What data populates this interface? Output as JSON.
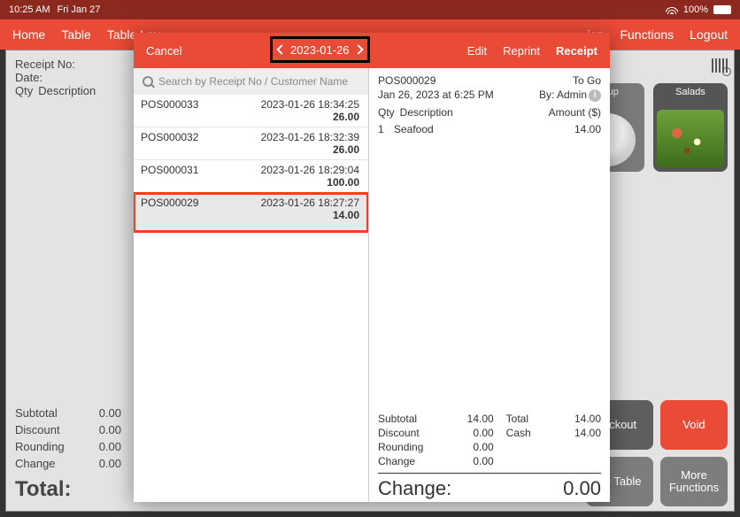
{
  "status": {
    "time": "10:25 AM",
    "date": "Fri Jan 27",
    "battery": "100%"
  },
  "topnav": {
    "home": "Home",
    "table": "Table",
    "layout": "Table Lay",
    "ion": "ion",
    "functions": "Functions",
    "logout": "Logout"
  },
  "background": {
    "receipt_no_label": "Receipt No:",
    "date_label": "Date:",
    "qty_label": "Qty",
    "desc_label": "Description",
    "subtotal_label": "Subtotal",
    "subtotal": "0.00",
    "discount_label": "Discount",
    "discount": "0.00",
    "rounding_label": "Rounding",
    "rounding": "0.00",
    "change_label": "Change",
    "change": "0.00",
    "total_label": "Total:",
    "products": {
      "soup": "Soup",
      "salads": "Salads"
    },
    "buttons": {
      "checkout": "eckout",
      "void": "Void",
      "change_table": "ge Table",
      "more": "More Functions"
    }
  },
  "modal": {
    "cancel": "Cancel",
    "date": "2023-01-26",
    "tabs": {
      "edit": "Edit",
      "reprint": "Reprint",
      "receipt": "Receipt"
    },
    "search_placeholder": "Search by Receipt No / Customer Name",
    "receipts": [
      {
        "no": "POS000033",
        "ts": "2023-01-26 18:34:25",
        "amt": "26.00"
      },
      {
        "no": "POS000032",
        "ts": "2023-01-26 18:32:39",
        "amt": "26.00"
      },
      {
        "no": "POS000031",
        "ts": "2023-01-26 18:29:04",
        "amt": "100.00"
      },
      {
        "no": "POS000029",
        "ts": "2023-01-26 18:27:27",
        "amt": "14.00"
      }
    ],
    "selected_index": 3,
    "detail": {
      "no": "POS000029",
      "type": "To Go",
      "when": "Jan 26, 2023 at 6:25 PM",
      "by_label": "By: Admin",
      "header_qty": "Qty",
      "header_desc": "Description",
      "header_amt": "Amount ($)",
      "items": [
        {
          "qty": "1",
          "desc": "Seafood",
          "amt": "14.00"
        }
      ],
      "totals": {
        "subtotal_l": "Subtotal",
        "subtotal_v": "14.00",
        "total_l": "Total",
        "total_v": "14.00",
        "discount_l": "Discount",
        "discount_v": "0.00",
        "cash_l": "Cash",
        "cash_v": "14.00",
        "rounding_l": "Rounding",
        "rounding_v": "0.00",
        "change_l": "Change",
        "change_v": "0.00"
      },
      "big_change_l": "Change:",
      "big_change_v": "0.00"
    }
  }
}
